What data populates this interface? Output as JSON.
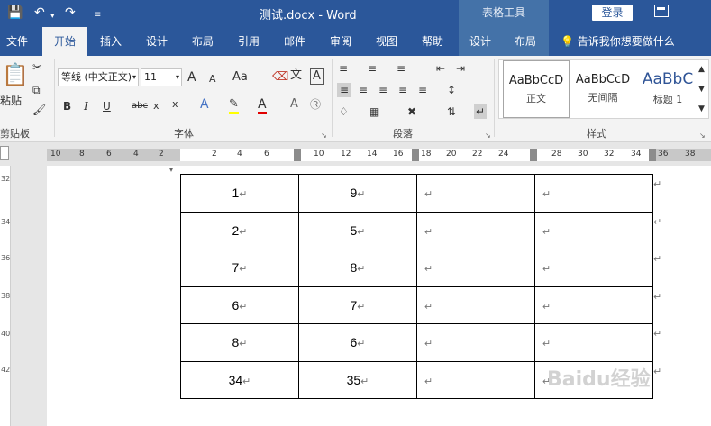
{
  "titlebar": {
    "doc_name": "测试.docx",
    "separator": "-",
    "app_name": "Word",
    "context_group": "表格工具",
    "login_label": "登录"
  },
  "tabs": [
    {
      "label": "文件",
      "active": false
    },
    {
      "label": "开始",
      "active": true
    },
    {
      "label": "插入",
      "active": false
    },
    {
      "label": "设计",
      "active": false
    },
    {
      "label": "布局",
      "active": false
    },
    {
      "label": "引用",
      "active": false
    },
    {
      "label": "邮件",
      "active": false
    },
    {
      "label": "审阅",
      "active": false
    },
    {
      "label": "视图",
      "active": false
    },
    {
      "label": "帮助",
      "active": false
    },
    {
      "label": "设计",
      "active": false
    },
    {
      "label": "布局",
      "active": false
    }
  ],
  "tell_me": "告诉我你想要做什么",
  "ribbon": {
    "clipboard": {
      "paste_label": "粘贴",
      "group_label": "剪贴板"
    },
    "font": {
      "font_name": "等线 (中文正文)",
      "font_size": "11",
      "grow_label": "A",
      "shrink_label": "A",
      "case_label": "Aa",
      "bold": "B",
      "italic": "I",
      "underline": "U",
      "strike": "abc",
      "subscript": "x",
      "superscript": "x",
      "group_label": "字体"
    },
    "paragraph": {
      "group_label": "段落"
    },
    "styles": {
      "items": [
        {
          "sample": "AaBbCcD",
          "name": "正文"
        },
        {
          "sample": "AaBbCcD",
          "name": "无间隔"
        },
        {
          "sample": "AaBbC",
          "name": "标题 1"
        }
      ],
      "group_label": "样式"
    }
  },
  "ruler": {
    "labels": [
      "10",
      "8",
      "6",
      "4",
      "2",
      "2",
      "4",
      "6",
      "10",
      "12",
      "14",
      "16",
      "18",
      "20",
      "22",
      "24",
      "28",
      "30",
      "32",
      "34",
      "36",
      "38"
    ]
  },
  "vruler": {
    "labels": [
      "32",
      "34",
      "36",
      "38",
      "40",
      "42"
    ]
  },
  "table": {
    "rows": [
      [
        "1",
        "9",
        "",
        ""
      ],
      [
        "2",
        "5",
        "",
        ""
      ],
      [
        "7",
        "8",
        "",
        ""
      ],
      [
        "6",
        "7",
        "",
        ""
      ],
      [
        "8",
        "6",
        "",
        ""
      ],
      [
        "34",
        "35",
        "",
        ""
      ]
    ]
  },
  "watermark": "Baidu经验"
}
